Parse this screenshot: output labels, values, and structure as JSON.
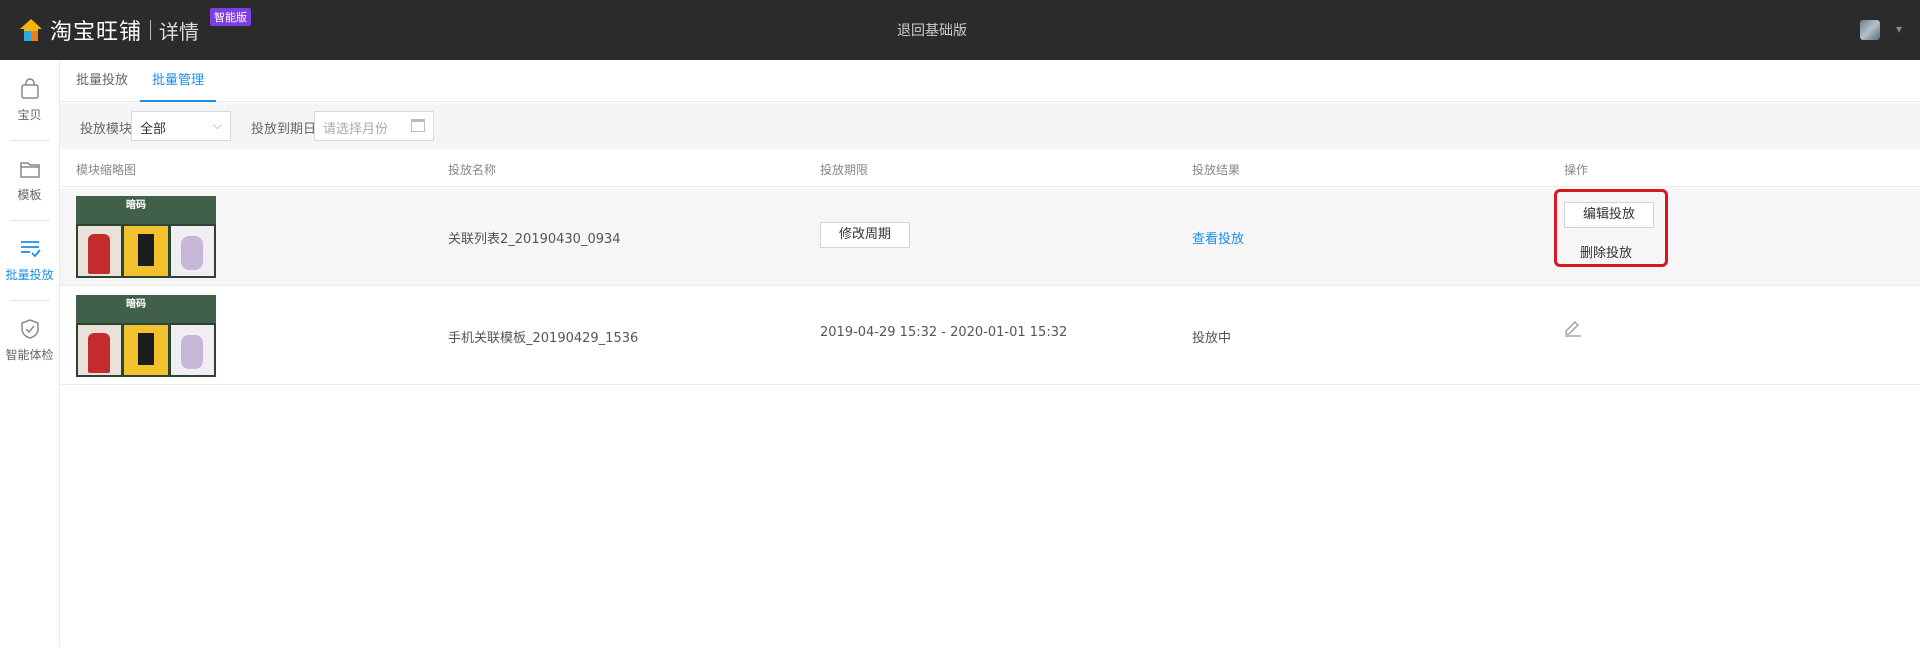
{
  "topbar": {
    "logo_text": "淘宝旺铺",
    "logo_sub": "详情",
    "badge": "智能版",
    "center_link": "退回基础版"
  },
  "sidebar": {
    "items": [
      {
        "label": "宝贝",
        "icon": "bag-icon"
      },
      {
        "label": "模板",
        "icon": "folder-icon"
      },
      {
        "label": "批量投放",
        "icon": "list-check-icon",
        "active": true
      },
      {
        "label": "智能体检",
        "icon": "shield-check-icon"
      }
    ]
  },
  "tabs": [
    {
      "label": "批量投放",
      "active": false
    },
    {
      "label": "批量管理",
      "active": true
    }
  ],
  "filter": {
    "module_label": "投放模块",
    "module_value": "全部",
    "expire_label": "投放到期日",
    "expire_placeholder": "请选择月份"
  },
  "table": {
    "headers": [
      "模块缩略图",
      "投放名称",
      "投放期限",
      "投放结果",
      "操作"
    ],
    "rows": [
      {
        "thumb_title": "暗码",
        "name": "关联列表2_20190430_0934",
        "period_button": "修改周期",
        "result_link": "查看投放",
        "actions": [
          "编辑投放",
          "删除投放"
        ]
      },
      {
        "thumb_title": "暗码",
        "name": "手机关联模板_20190429_1536",
        "period": "2019-04-29 15:32 - 2020-01-01 15:32",
        "result": "投放中",
        "action_icon": "pencil-icon"
      }
    ]
  },
  "colors": {
    "accent": "#1a8fe6",
    "topbar": "#2b2b2b",
    "highlight": "#d9171f",
    "badge": "#7b3fe4"
  }
}
